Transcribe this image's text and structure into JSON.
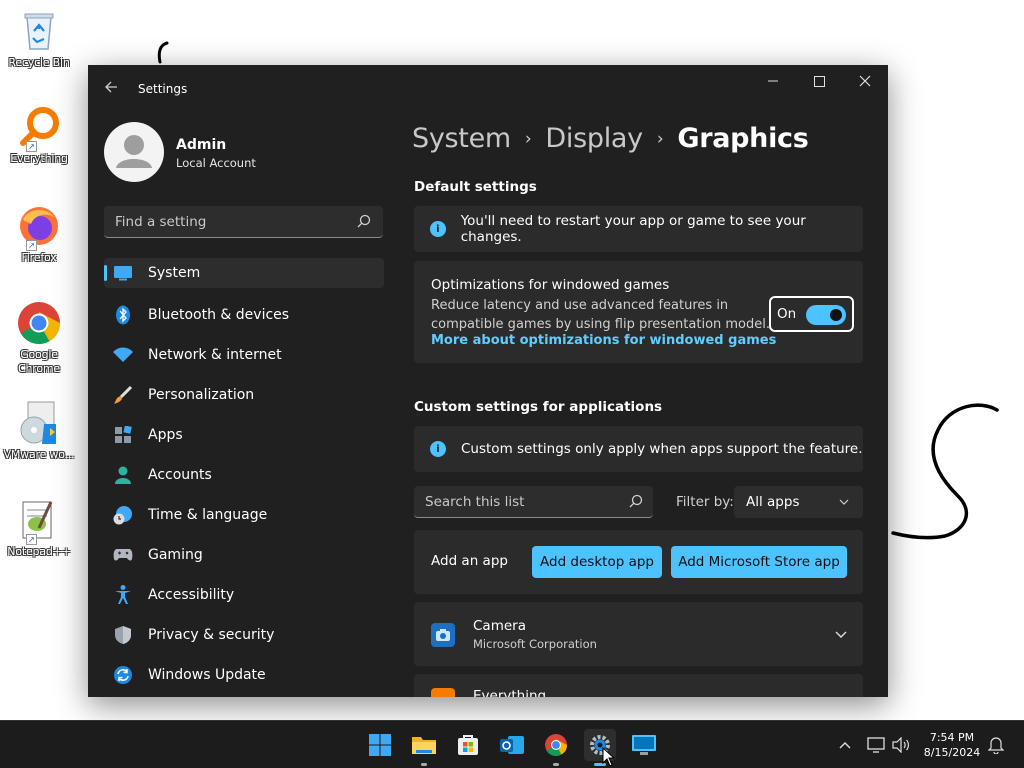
{
  "desktop": {
    "icons": [
      {
        "label": "Recycle Bin"
      },
      {
        "label": "Everything"
      },
      {
        "label": "Firefox"
      },
      {
        "label": "Google Chrome"
      },
      {
        "label": "VMware wo..."
      },
      {
        "label": "Notepad++"
      }
    ]
  },
  "window": {
    "title": "Settings",
    "profile": {
      "name": "Admin",
      "account_type": "Local Account"
    },
    "search_placeholder": "Find a setting",
    "nav": [
      {
        "label": "System",
        "icon": "monitor-icon"
      },
      {
        "label": "Bluetooth & devices",
        "icon": "bluetooth-icon"
      },
      {
        "label": "Network & internet",
        "icon": "wifi-icon"
      },
      {
        "label": "Personalization",
        "icon": "brush-icon"
      },
      {
        "label": "Apps",
        "icon": "apps-icon"
      },
      {
        "label": "Accounts",
        "icon": "person-icon"
      },
      {
        "label": "Time & language",
        "icon": "clock-globe-icon"
      },
      {
        "label": "Gaming",
        "icon": "gamepad-icon"
      },
      {
        "label": "Accessibility",
        "icon": "accessibility-icon"
      },
      {
        "label": "Privacy & security",
        "icon": "shield-icon"
      },
      {
        "label": "Windows Update",
        "icon": "update-icon"
      }
    ],
    "breadcrumb": [
      "System",
      "Display",
      "Graphics"
    ]
  },
  "content": {
    "default_settings": {
      "title": "Default settings",
      "restart_info": "You'll need to restart your app or game to see your changes.",
      "optimization": {
        "title": "Optimizations for windowed games",
        "description": "Reduce latency and use advanced features in compatible games by using flip presentation model.",
        "link": "More about optimizations for windowed games",
        "toggle_label": "On",
        "toggle_on": true
      }
    },
    "custom_settings": {
      "title": "Custom settings for applications",
      "info": "Custom settings only apply when apps support the feature.",
      "search_placeholder": "Search this list",
      "filter_label": "Filter by:",
      "filter_value": "All apps",
      "add_app_label": "Add an app",
      "add_desktop_button": "Add desktop app",
      "add_store_button": "Add Microsoft Store app",
      "apps": [
        {
          "name": "Camera",
          "publisher": "Microsoft Corporation"
        },
        {
          "name": "Everything",
          "publisher": ""
        }
      ]
    }
  },
  "taskbar": {
    "apps": [
      "start-icon",
      "file-explorer-icon",
      "microsoft-store-icon",
      "outlook-icon",
      "chrome-icon",
      "settings-icon",
      "remote-desktop-icon"
    ],
    "clock": {
      "time": "7:54 PM",
      "date": "8/15/2024"
    }
  },
  "colors": {
    "accent": "#4cc2ff",
    "window_bg": "#202020",
    "card_bg": "#2b2b2b",
    "link": "#60cdff"
  }
}
